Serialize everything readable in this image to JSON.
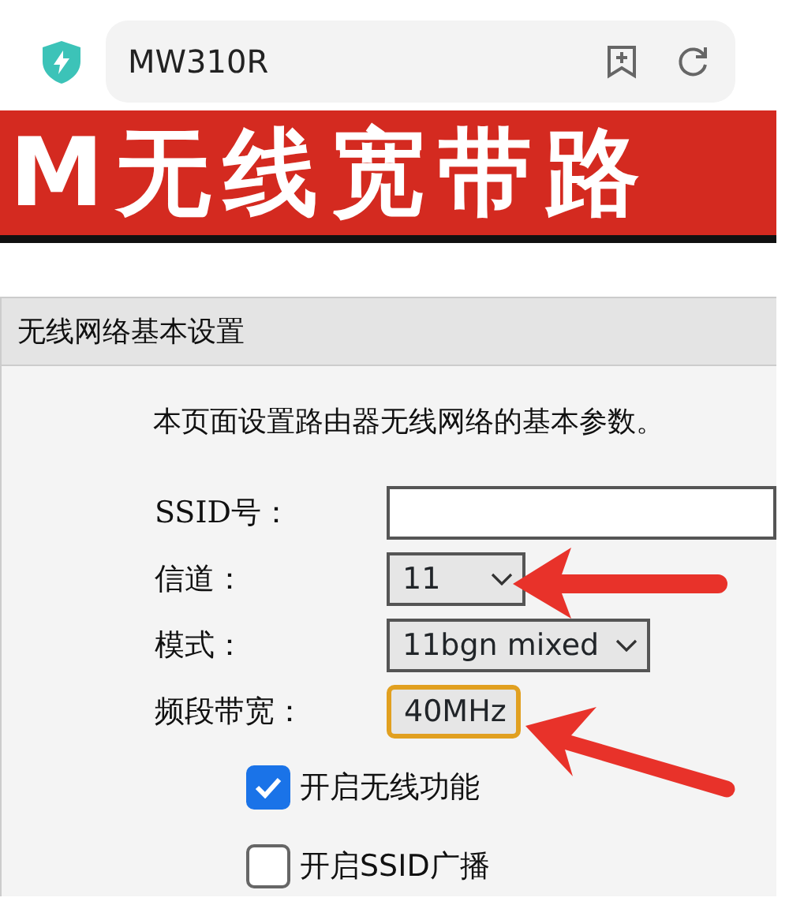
{
  "address_bar": {
    "title": "MW310R"
  },
  "banner": {
    "text": "M无线宽带路"
  },
  "panel": {
    "title": "无线网络基本设置",
    "description": "本页面设置路由器无线网络的基本参数。",
    "fields": [
      {
        "kind": "text",
        "label": "SSID号："
      },
      {
        "kind": "select",
        "label": "信道：",
        "value": "11",
        "focused": false,
        "caret": true
      },
      {
        "kind": "select",
        "label": "模式：",
        "value": "11bgn mixed",
        "focused": false,
        "caret": true
      },
      {
        "kind": "select",
        "label": "频段带宽：",
        "value": "40MHz",
        "focused": true,
        "caret": false
      }
    ],
    "checkboxes": [
      {
        "label": "开启无线功能",
        "checked": true
      },
      {
        "label": "开启SSID广播",
        "checked": false
      }
    ]
  }
}
